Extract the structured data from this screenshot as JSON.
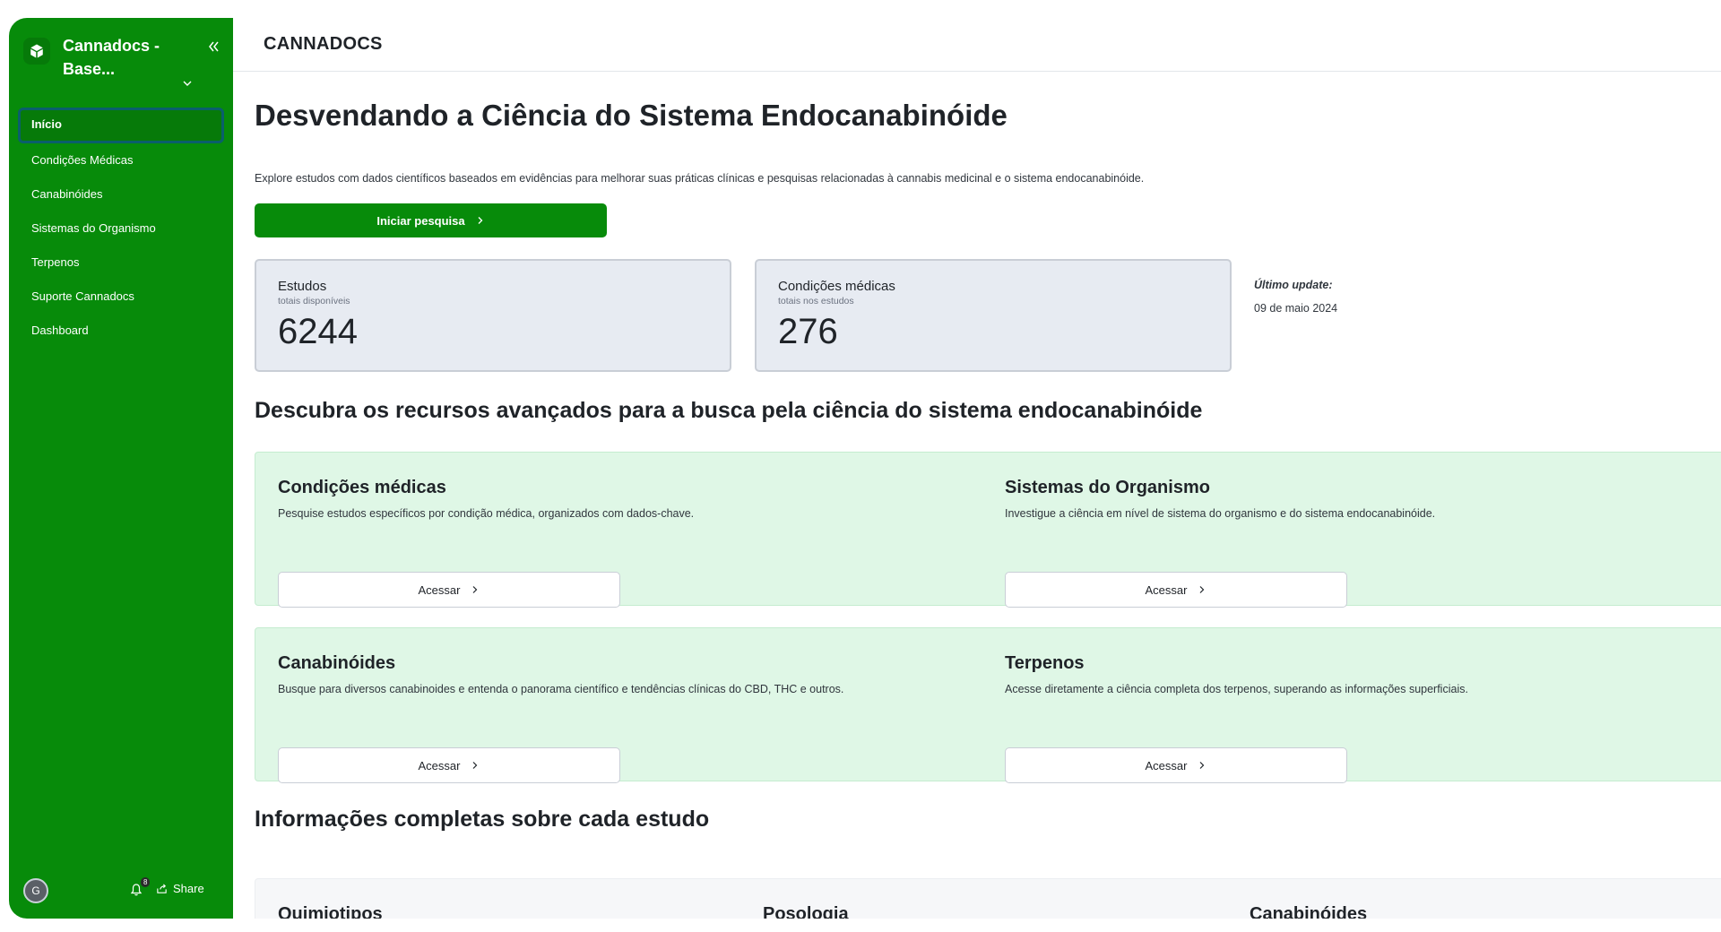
{
  "sidebar": {
    "brand_title": "Cannadocs - Base...",
    "items": [
      {
        "label": "Início",
        "active": true
      },
      {
        "label": "Condições Médicas"
      },
      {
        "label": "Canabinóides"
      },
      {
        "label": "Sistemas do Organismo"
      },
      {
        "label": "Terpenos"
      },
      {
        "label": "Suporte Cannadocs"
      },
      {
        "label": "Dashboard"
      }
    ],
    "avatar_initial": "G",
    "notification_count": "8",
    "share_label": "Share",
    "color": "#078b0a"
  },
  "header": {
    "title": "CANNADOCS"
  },
  "hero": {
    "title": "Desvendando a Ciência do Sistema Endocanabinóide",
    "subtitle": "Explore estudos com dados científicos baseados em evidências para melhorar suas práticas clínicas e pesquisas relacionadas à cannabis medicinal e o sistema endocanabinóide.",
    "cta_label": "Iniciar pesquisa"
  },
  "stats": [
    {
      "label": "Estudos",
      "sub": "totais disponíveis",
      "value": "6244"
    },
    {
      "label": "Condições médicas",
      "sub": "totais nos estudos",
      "value": "276"
    }
  ],
  "update": {
    "label": "Último update:",
    "date": "09 de maio 2024"
  },
  "features_section": {
    "title": "Descubra os recursos avançados para a busca pela ciência do sistema endocanabinóide",
    "items": [
      {
        "title": "Condições médicas",
        "desc": "Pesquise estudos específicos por condição médica, organizados com dados-chave.",
        "button": "Acessar"
      },
      {
        "title": "Sistemas do Organismo",
        "desc": "Investigue a ciência em nível de sistema do organismo e do sistema endocanabinóide.",
        "button": "Acessar"
      },
      {
        "title": "Canabinóides",
        "desc": "Busque para diversos canabinoides e entenda o panorama científico e tendências clínicas do CBD, THC e outros.",
        "button": "Acessar"
      },
      {
        "title": "Terpenos",
        "desc": "Acesse diretamente a ciência completa dos terpenos, superando as informações superficiais.",
        "button": "Acessar"
      }
    ]
  },
  "info_section": {
    "title": "Informações completas sobre cada estudo",
    "columns": [
      "Quimiotipos",
      "Posologia",
      "Canabinóides"
    ]
  }
}
